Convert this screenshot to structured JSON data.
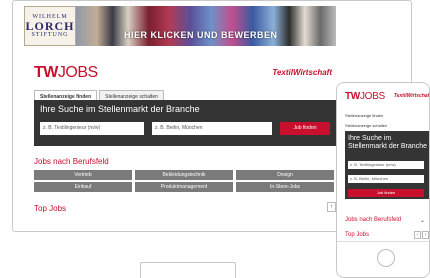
{
  "banner": {
    "logo_line1": "WILHELM",
    "logo_line2": "LORCH",
    "logo_line3": "STIFTUNG",
    "cta": "HIER KLICKEN UND BEWERBEN"
  },
  "brand": {
    "tw": "TW",
    "jobs": "JOBS",
    "publisher": "TextilWirtschaft"
  },
  "tabs": [
    "Stellenanzeige finden",
    "Stellenanzeige schalten"
  ],
  "search": {
    "title": "Ihre Suche im Stellenmarkt der Branche",
    "what_placeholder": "z. B. Textilingenieur (m/w)",
    "where_placeholder": "z. B. Berlin, München",
    "button": "Job finden"
  },
  "categories": {
    "title": "Jobs nach Berufsfeld",
    "items": [
      "Vertrieb",
      "Bekleidungstechnik",
      "Design",
      "Einkauf",
      "Produktmanagement",
      "In-Store-Jobs"
    ]
  },
  "top_jobs": {
    "title": "Top Jobs",
    "prev": "‹",
    "next": "›"
  },
  "mobile": {
    "section_chevron": "⌄"
  }
}
